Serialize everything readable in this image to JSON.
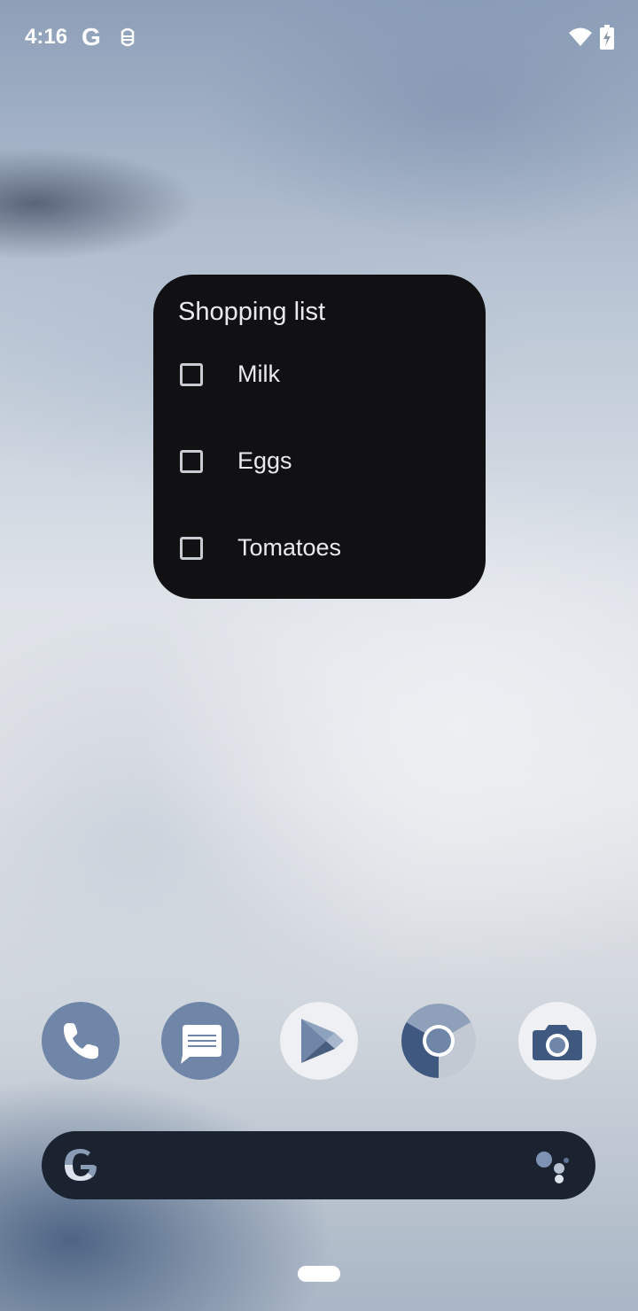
{
  "status_bar": {
    "time": "4:16",
    "g_label": "G",
    "icons": [
      "google-icon",
      "debug-bug-icon",
      "wifi-icon",
      "battery-charging-icon"
    ]
  },
  "widget": {
    "title": "Shopping list",
    "items": [
      {
        "label": "Milk",
        "checked": false
      },
      {
        "label": "Eggs",
        "checked": false
      },
      {
        "label": "Tomatoes",
        "checked": false
      }
    ]
  },
  "dock": {
    "apps": [
      "phone-icon",
      "messages-icon",
      "play-store-icon",
      "chrome-icon",
      "camera-icon"
    ]
  },
  "search_bar": {
    "icons": [
      "google-g-icon",
      "assistant-icon"
    ]
  },
  "colors": {
    "widget_bg": "#111114",
    "icon_tint": "#6f86a8",
    "search_bg": "#1b2230"
  }
}
